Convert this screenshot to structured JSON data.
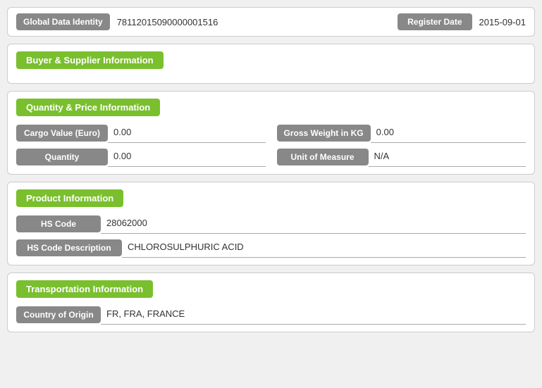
{
  "header": {
    "gdi_label": "Global Data Identity",
    "gdi_value": "78112015090000001516",
    "register_label": "Register Date",
    "register_value": "2015-09-01"
  },
  "buyer_supplier": {
    "title": "Buyer & Supplier Information"
  },
  "quantity_price": {
    "title": "Quantity & Price Information",
    "cargo_label": "Cargo Value (Euro)",
    "cargo_value": "0.00",
    "gross_label": "Gross Weight in KG",
    "gross_value": "0.00",
    "quantity_label": "Quantity",
    "quantity_value": "0.00",
    "uom_label": "Unit of Measure",
    "uom_value": "N/A"
  },
  "product": {
    "title": "Product Information",
    "hs_code_label": "HS Code",
    "hs_code_value": "28062000",
    "hs_desc_label": "HS Code Description",
    "hs_desc_value": "CHLOROSULPHURIC ACID"
  },
  "transportation": {
    "title": "Transportation Information",
    "origin_label": "Country of Origin",
    "origin_value": "FR, FRA, FRANCE"
  }
}
